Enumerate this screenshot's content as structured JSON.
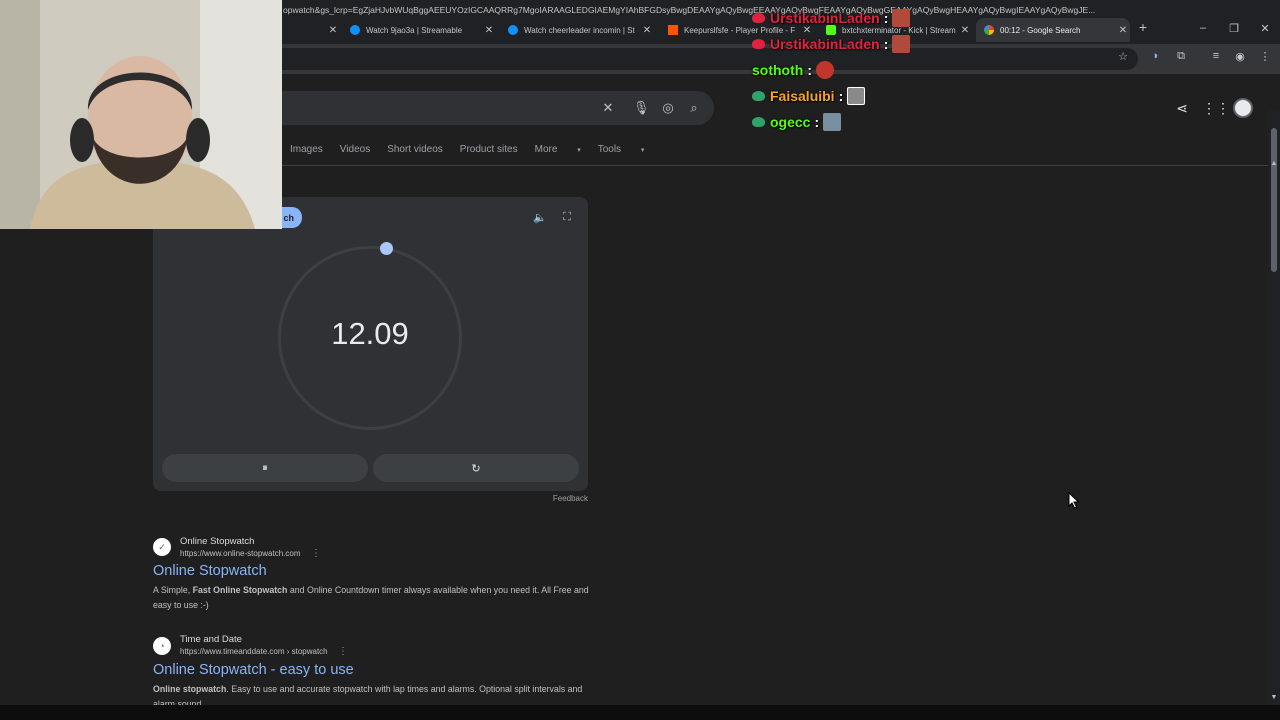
{
  "browser": {
    "tabs": [
      {
        "title": "Watch 9jao3a | Streamable",
        "icon": "streamable-icon"
      },
      {
        "title": "Watch cheerleader incomin | St",
        "icon": "streamable-icon"
      },
      {
        "title": "Keepurslfsfe - Player Profile - F",
        "icon": "faceit-icon"
      },
      {
        "title": "bxtchxterminator - Kick | Stream",
        "icon": "kick-icon"
      },
      {
        "title": "00:12 - Google Search",
        "icon": "google-icon",
        "active": true
      }
    ],
    "url": "opwatch&gs_lcrp=EgZjaHJvbWUqBggAEEUYOzIGCAAQRRg7MgoIARAAGLEDGIAEMgYIAhBFGDsyBwgDEAAYgAQyBwgEEAAYgAQyBwgFEAAYgAQyBwgGEAAYgAQyBwgHEAAYgAQyBwgIEAAYgAQyBwgJE..."
  },
  "google": {
    "nav_tabs": [
      "Images",
      "Videos",
      "Short videos",
      "Product sites",
      "More",
      "Tools"
    ],
    "stopwatch": {
      "tab_label": "ch",
      "time": "12.09",
      "pause_glyph": "⏸",
      "reset_glyph": "↻",
      "feedback": "Feedback"
    },
    "results": [
      {
        "site": "Online Stopwatch",
        "url": "https://www.online-stopwatch.com",
        "title": "Online Stopwatch",
        "snippet_pre": "A Simple, ",
        "snippet_bold": "Fast Online Stopwatch",
        "snippet_post": " and Online Countdown timer always available when you need it. All Free and easy to use :-)"
      },
      {
        "site": "Time and Date",
        "url": "https://www.timeanddate.com › stopwatch",
        "title": "Online Stopwatch - easy to use",
        "snippet_pre": "",
        "snippet_bold": "Online stopwatch",
        "snippet_post": ". Easy to use and accurate stopwatch with lap times and alarms. Optional split intervals and alarm sound."
      }
    ]
  },
  "chat": [
    {
      "user": "UrstikabinLaden",
      "color": "#e0243f",
      "badge": "#e0243f"
    },
    {
      "user": "UrstikabinLaden",
      "color": "#e0243f",
      "badge": "#e0243f"
    },
    {
      "user": "sothoth",
      "color": "#53fc18",
      "badge": "none"
    },
    {
      "user": "Faisaluibi",
      "color": "#f5a623",
      "badge": "#2fa36b"
    },
    {
      "user": "ogecc",
      "color": "#53fc18",
      "badge": "#2fa36b"
    }
  ],
  "chat_separator": ":"
}
